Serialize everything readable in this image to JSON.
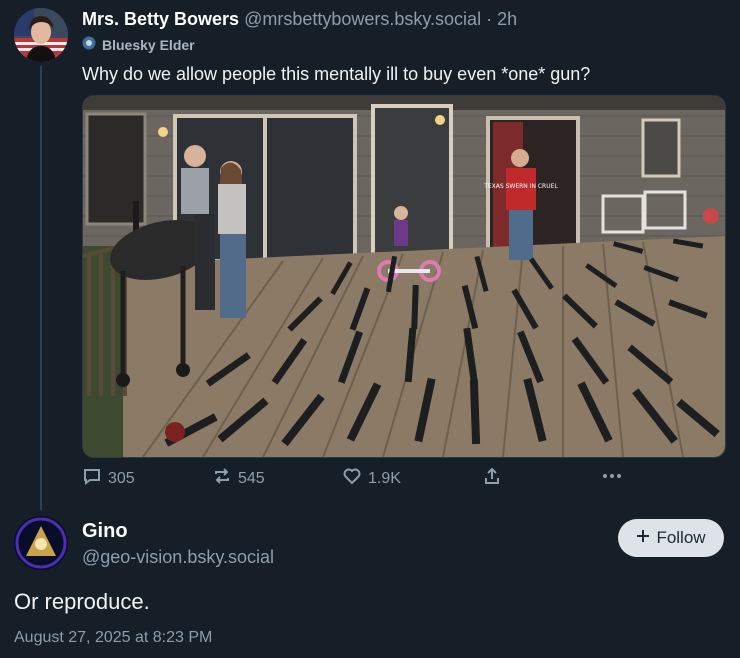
{
  "post": {
    "author_name": "Mrs. Betty Bowers",
    "author_handle": "@mrsbettybowers.bsky.social",
    "separator": "·",
    "time": "2h",
    "badge": "Bluesky Elder",
    "text": "Why do we allow people this mentally ill to buy even *one* gun?",
    "actions": {
      "replies": "305",
      "reposts": "545",
      "likes": "1.9K"
    },
    "photo": {
      "shirt_text": "TEXAS SWERN IN CRUEL"
    }
  },
  "reply": {
    "author_name": "Gino",
    "author_handle": "@geo-vision.bsky.social",
    "follow_label": "Follow",
    "text": "Or reproduce.",
    "timestamp": "August 27, 2025 at 8:23 PM"
  },
  "icons": {
    "reply": "speech-bubble-icon",
    "repost": "repost-arrows-icon",
    "like": "heart-icon",
    "share": "share-upload-icon",
    "more": "more-dots-icon",
    "follow": "plus-icon"
  },
  "colors": {
    "background": "#161e27",
    "muted": "#8d9ead",
    "follow_bg": "#dde3e9"
  }
}
